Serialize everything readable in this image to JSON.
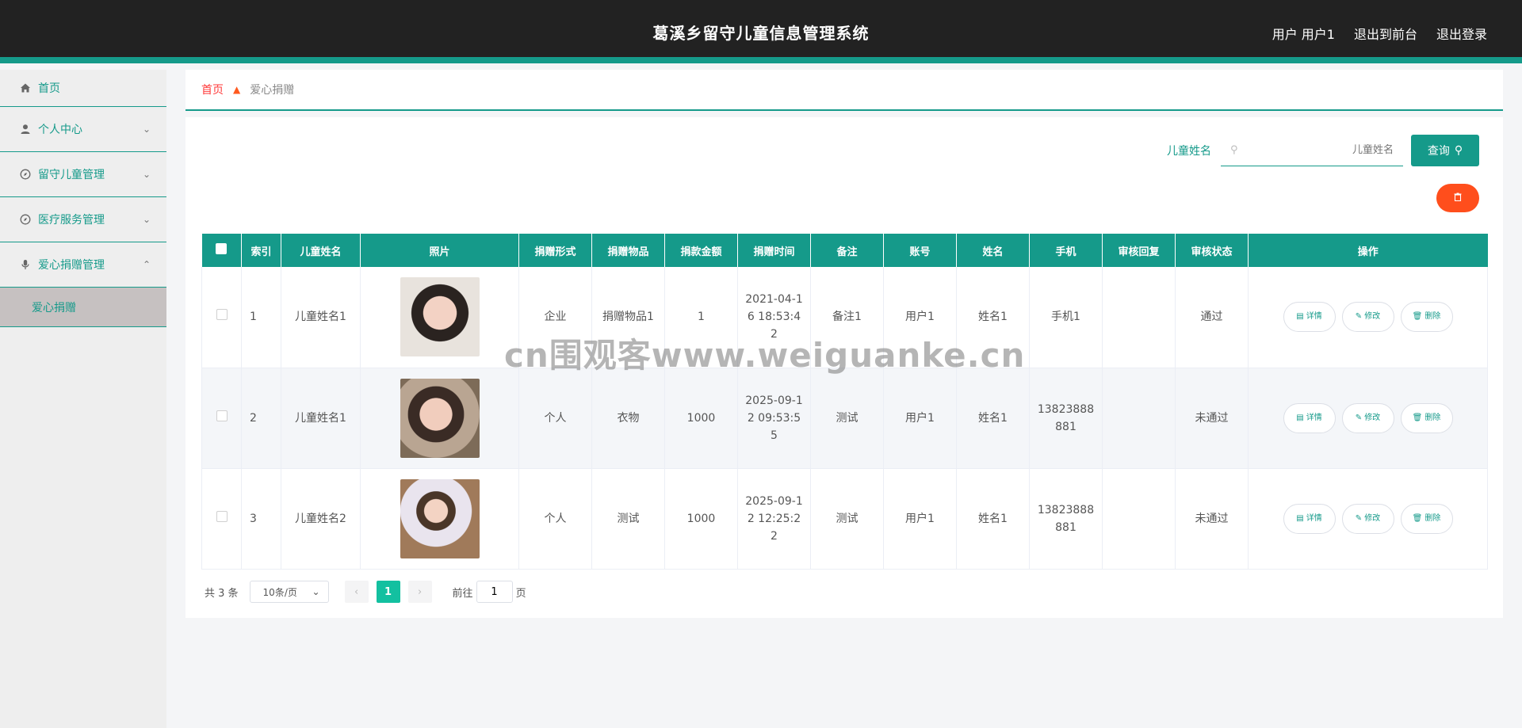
{
  "header": {
    "title": "葛溪乡留守儿童信息管理系统",
    "user_label": "用户 用户1",
    "to_front": "退出到前台",
    "logout": "退出登录"
  },
  "sidebar": {
    "items": [
      {
        "label": "首页",
        "icon": "home-icon"
      },
      {
        "label": "个人中心",
        "icon": "user-icon"
      },
      {
        "label": "留守儿童管理",
        "icon": "compass-icon"
      },
      {
        "label": "医疗服务管理",
        "icon": "compass-icon"
      },
      {
        "label": "爱心捐赠管理",
        "icon": "mic-icon"
      }
    ],
    "sub_active": "爱心捐赠"
  },
  "breadcrumb": {
    "home": "首页",
    "current": "爱心捐赠"
  },
  "search": {
    "label": "儿童姓名",
    "placeholder": "儿童姓名",
    "button": "查询"
  },
  "table": {
    "headers": [
      "索引",
      "儿童姓名",
      "照片",
      "捐赠形式",
      "捐赠物品",
      "捐款金额",
      "捐赠时间",
      "备注",
      "账号",
      "姓名",
      "手机",
      "审核回复",
      "审核状态",
      "操作"
    ],
    "rows": [
      {
        "index": "1",
        "child": "儿童姓名1",
        "form": "企业",
        "item": "捐赠物品1",
        "amount": "1",
        "time": "2021-04-16 18:53:42",
        "note": "备注1",
        "account": "用户1",
        "name": "姓名1",
        "phone": "手机1",
        "reply": "",
        "status": "通过"
      },
      {
        "index": "2",
        "child": "儿童姓名1",
        "form": "个人",
        "item": "衣物",
        "amount": "1000",
        "time": "2025-09-12 09:53:55",
        "note": "测试",
        "account": "用户1",
        "name": "姓名1",
        "phone": "13823888881",
        "reply": "",
        "status": "未通过"
      },
      {
        "index": "3",
        "child": "儿童姓名2",
        "form": "个人",
        "item": "测试",
        "amount": "1000",
        "time": "2025-09-12 12:25:22",
        "note": "测试",
        "account": "用户1",
        "name": "姓名1",
        "phone": "13823888881",
        "reply": "",
        "status": "未通过"
      }
    ],
    "actions": {
      "detail": "详情",
      "edit": "修改",
      "delete": "删除"
    }
  },
  "pager": {
    "total": "共 3 条",
    "page_size": "10条/页",
    "current_page": "1",
    "goto_prefix": "前往",
    "goto_value": "1",
    "goto_suffix": "页"
  },
  "watermark": "cn围观客www.weiguanke.cn",
  "colors": {
    "accent": "#159a8a",
    "header_bg": "#222222",
    "danger": "#ff4e1c"
  }
}
